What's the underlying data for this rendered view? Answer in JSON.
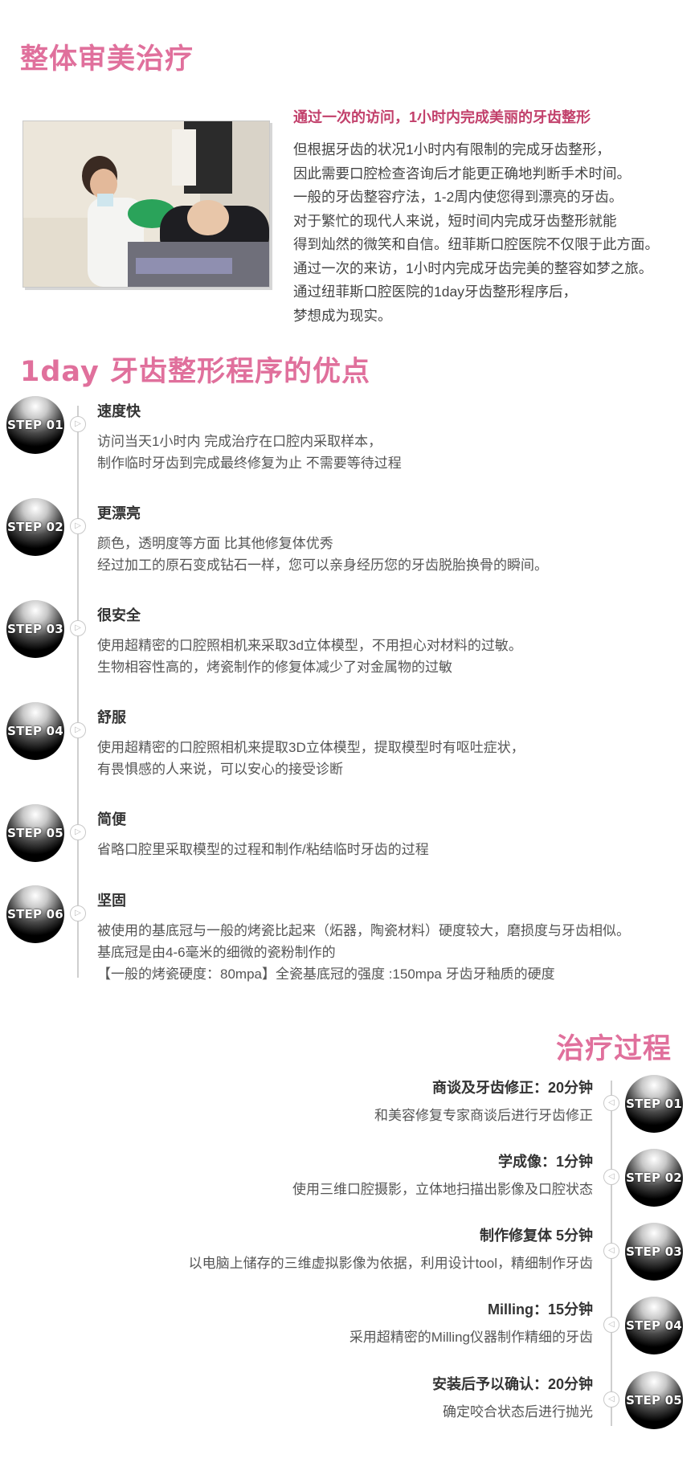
{
  "section1": {
    "heading": "整体审美治疗",
    "intro_title": "通过一次的访问，1小时内完成美丽的牙齿整形",
    "intro_lines": [
      "但根据牙齿的状况1小时内有限制的完成牙齿整形，",
      "因此需要口腔检查咨询后才能更正确地判断手术时间。",
      "一般的牙齿整容疗法，1-2周内使您得到漂亮的牙齿。",
      "对于繁忙的现代人来说，短时间内完成牙齿整形就能",
      "得到灿然的微笑和自信。纽菲斯口腔医院不仅限于此方面。",
      "通过一次的来访，1小时内完成牙齿完美的整容如梦之旅。",
      "通过纽菲斯口腔医院的1day牙齿整形程序后，",
      "梦想成为现实。"
    ]
  },
  "section2": {
    "heading": "1day 牙齿整形程序的优点",
    "steps": [
      {
        "badge": "STEP 01",
        "title": "速度快",
        "desc": [
          "访问当天1小时内 完成治疗在口腔内采取样本，",
          "制作临时牙齿到完成最终修复为止 不需要等待过程"
        ]
      },
      {
        "badge": "STEP 02",
        "title": "更漂亮",
        "desc": [
          "颜色，透明度等方面 比其他修复体优秀",
          "经过加工的原石变成钻石一样，您可以亲身经历您的牙齿脱胎换骨的瞬间。"
        ]
      },
      {
        "badge": "STEP 03",
        "title": "很安全",
        "desc": [
          "使用超精密的口腔照相机来采取3d立体模型，不用担心对材料的过敏。",
          "生物相容性高的，烤瓷制作的修复体减少了对金属物的过敏"
        ]
      },
      {
        "badge": "STEP 04",
        "title": "舒服",
        "desc": [
          "使用超精密的口腔照相机来提取3D立体模型，提取模型时有呕吐症状，",
          "有畏惧感的人来说，可以安心的接受诊断"
        ]
      },
      {
        "badge": "STEP 05",
        "title": "简便",
        "desc": [
          "省略口腔里采取模型的过程和制作/粘结临时牙齿的过程"
        ]
      },
      {
        "badge": "STEP 06",
        "title": "坚固",
        "desc": [
          "被使用的基底冠与一般的烤瓷比起来（炻器，陶瓷材料）硬度较大，磨损度与牙齿相似。",
          "基底冠是由4-6毫米的细微的瓷粉制作的",
          "【一般的烤瓷硬度：80mpa】全瓷基底冠的强度 :150mpa 牙齿牙釉质的硬度"
        ]
      }
    ]
  },
  "section3": {
    "heading": "治疗过程",
    "steps": [
      {
        "badge": "STEP 01",
        "title": "商谈及牙齿修正：20分钟",
        "desc": "和美容修复专家商谈后进行牙齿修正"
      },
      {
        "badge": "STEP 02",
        "title": "学成像：1分钟",
        "desc": "使用三维口腔摄影，立体地扫描出影像及口腔状态"
      },
      {
        "badge": "STEP 03",
        "title": "制作修复体 5分钟",
        "desc": "以电脑上储存的三维虚拟影像为依据，利用设计tool，精细制作牙齿"
      },
      {
        "badge": "STEP 04",
        "title": "Milling：15分钟",
        "desc": "采用超精密的Milling仪器制作精细的牙齿"
      },
      {
        "badge": "STEP 05",
        "title": "安装后予以确认：20分钟",
        "desc": "确定咬合状态后进行抛光"
      }
    ]
  },
  "colors": {
    "accent_pink": "#e0709c",
    "intro_title": "#c2406b",
    "badge": "#000000"
  }
}
